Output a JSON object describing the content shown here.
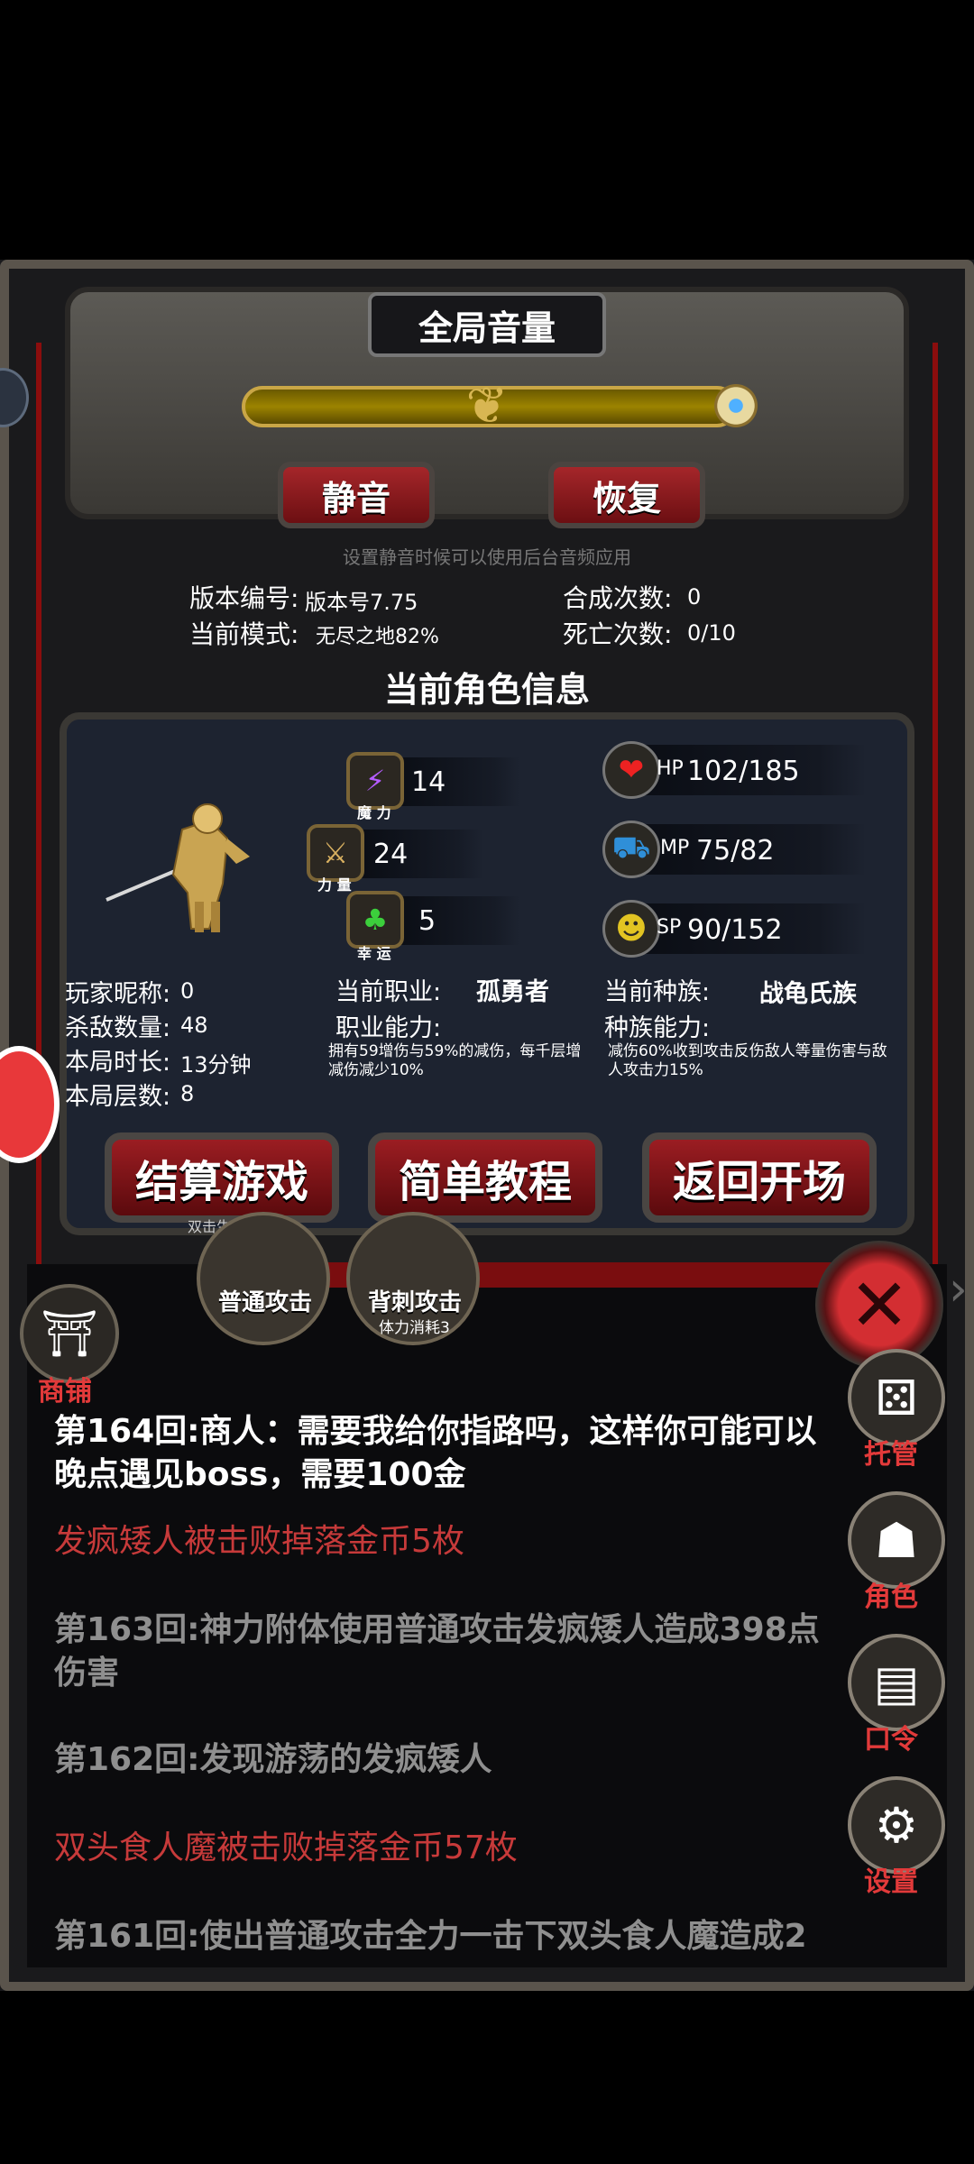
{
  "volume": {
    "title": "全局音量",
    "level": 1.0,
    "mute_label": "静音",
    "restore_label": "恢复",
    "hint": "设置静音时候可以使用后台音频应用"
  },
  "game_info": {
    "version_label": "版本编号:",
    "version_value": "版本号7.75",
    "mode_label": "当前模式:",
    "mode_value": "无尽之地82%",
    "synth_label": "合成次数:",
    "synth_value": "0",
    "death_label": "死亡次数:",
    "death_value": "0/10"
  },
  "character": {
    "section_title": "当前角色信息",
    "stats": [
      {
        "icon": "lightning-icon",
        "value": "14",
        "caption": "魔 力"
      },
      {
        "icon": "sword-icon",
        "value": "24",
        "caption": "力 量"
      },
      {
        "icon": "clover-icon",
        "value": "5",
        "caption": "幸 运"
      }
    ],
    "resources": [
      {
        "icon": "heart-icon",
        "label": "HP",
        "value": "102/185"
      },
      {
        "icon": "mana-cart-icon",
        "label": "MP",
        "value": "75/82"
      },
      {
        "icon": "strongman-icon",
        "label": "SP",
        "value": "90/152"
      }
    ],
    "nickname_label": "玩家昵称:",
    "nickname_value": "0",
    "kills_label": "杀敌数量:",
    "kills_value": "48",
    "duration_label": "本局时长:",
    "duration_value": "13分钟",
    "floor_label": "本局层数:",
    "floor_value": "8",
    "job_label": "当前职业:",
    "job_value": "孤勇者",
    "job_ability_label": "职业能力:",
    "job_ability_desc": "拥有59增伤与59%的减伤，每千层增减伤减少10%",
    "race_label": "当前种族:",
    "race_value": "战龟氏族",
    "race_ability_label": "种族能力:",
    "race_ability_desc": "减伤60%收到攻击反伤敌人等量伤害与敌人攻击力15%"
  },
  "actions": {
    "settle_label": "结算游戏",
    "settle_sub": "双击生效",
    "tutorial_label": "简单教程",
    "return_label": "返回开场"
  },
  "skills": [
    {
      "label": "普通攻击",
      "sub": ""
    },
    {
      "label": "背刺攻击",
      "sub": "体力消耗3"
    }
  ],
  "side": {
    "shop_label": "商铺",
    "auto_label": "托管",
    "role_label": "角色",
    "code_label": "口令",
    "settings_label": "设置"
  },
  "log": [
    {
      "text": "第164回:商人：需要我给你指路吗，这样你可能可以晚点遇见boss，需要100金",
      "style": "white"
    },
    {
      "text": "发疯矮人被击败掉落金币5枚",
      "style": "red"
    },
    {
      "text": "第163回:神力附体使用普通攻击发疯矮人造成398点伤害",
      "style": "grey"
    },
    {
      "text": "第162回:发现游荡的发疯矮人",
      "style": "grey"
    },
    {
      "text": "双头食人魔被击败掉落金币57枚",
      "style": "red"
    },
    {
      "text": "第161回:使出普通攻击全力一击下双头食人魔造成2",
      "style": "grey"
    }
  ]
}
